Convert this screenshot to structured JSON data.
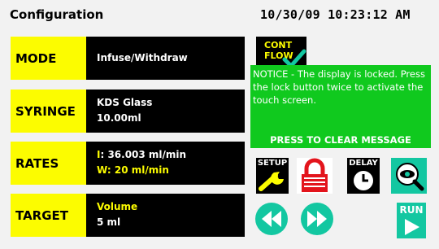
{
  "header": {
    "title": "Configuration",
    "datetime": "10/30/09 10:23:12 AM"
  },
  "rows": [
    {
      "label": "MODE",
      "line1": "Infuse/Withdraw",
      "line2": ""
    },
    {
      "label": "SYRINGE",
      "line1": "KDS Glass",
      "line2": "10.00ml"
    },
    {
      "label": "RATES",
      "line1_prefix": "I",
      "line1_value": ": 36.003 ml/min",
      "line2_prefix": "W",
      "line2_value": ": 20 ml/min"
    },
    {
      "label": "TARGET",
      "line1": "Volume",
      "line2": "5 ml"
    }
  ],
  "cont_flow": {
    "label": "CONT FLOW"
  },
  "notice": {
    "message": "NOTICE - The display is locked. Press the lock button twice to activate the touch screen.",
    "clear": "PRESS TO CLEAR MESSAGE"
  },
  "buttons": {
    "setup": "SETUP",
    "delay": "DELAY",
    "run": "RUN"
  },
  "icons": {
    "check": "check-icon",
    "wrench": "wrench-icon",
    "lock": "lock-icon",
    "clock": "clock-icon",
    "view": "eye-magnifier-icon",
    "rewind": "rewind-icon",
    "fast_forward": "fast-forward-icon",
    "play": "play-icon"
  },
  "colors": {
    "label_yellow": "#fcfc00",
    "notice_green": "#10c91e",
    "button_green": "#13c7a1",
    "lock_red": "#e3141c"
  }
}
